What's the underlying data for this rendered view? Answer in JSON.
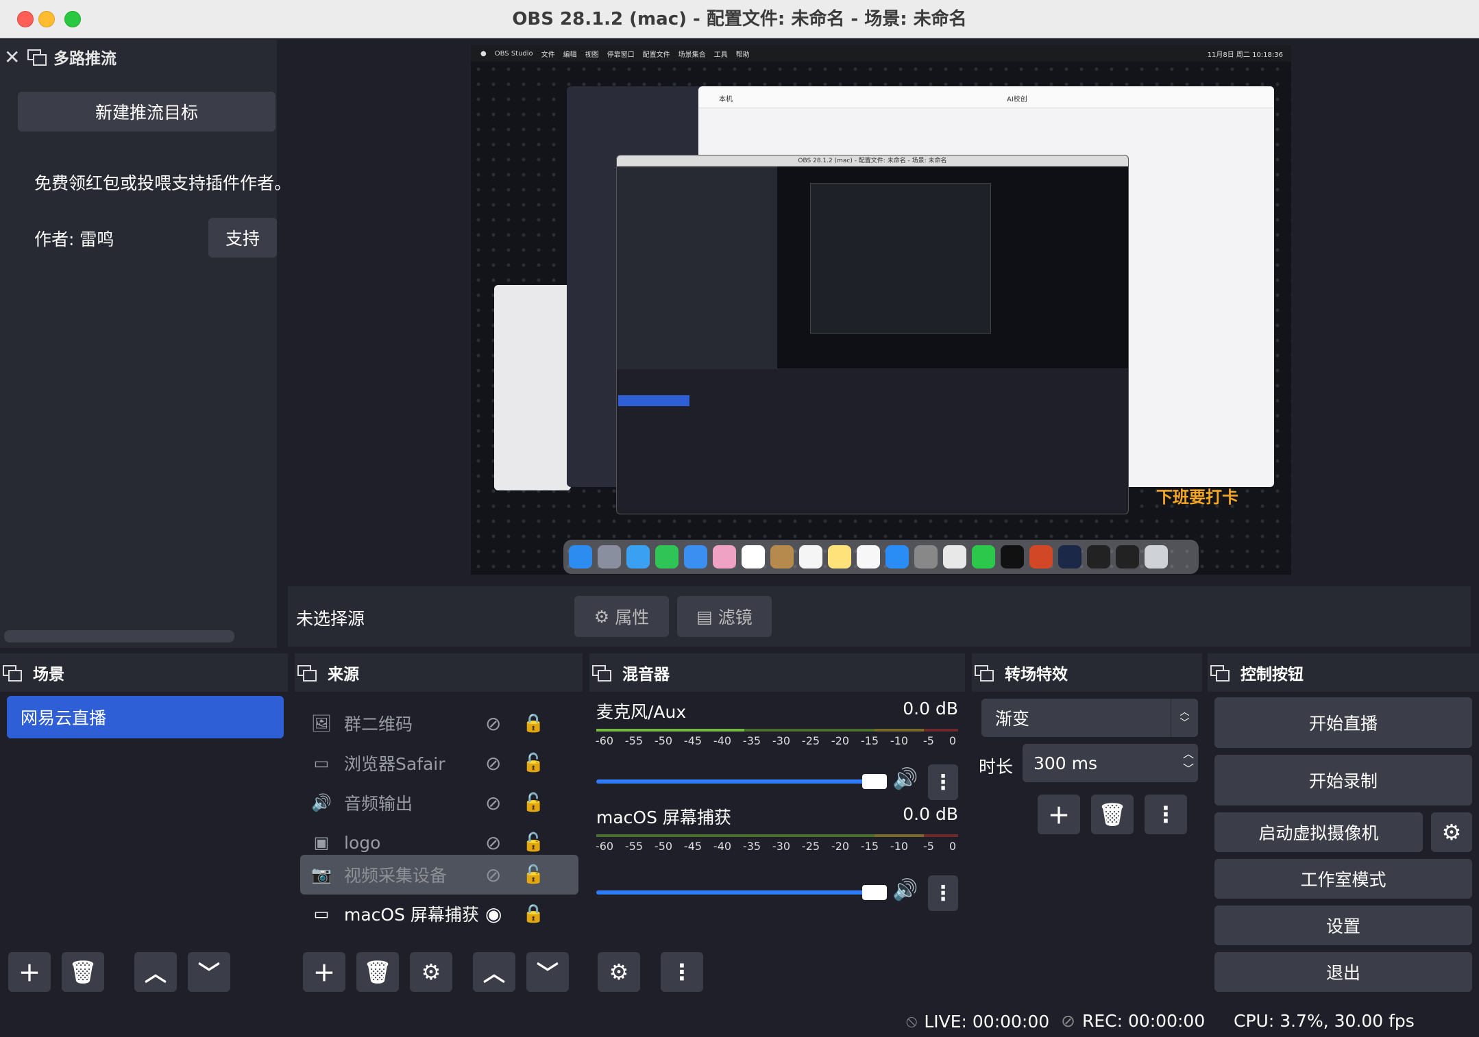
{
  "window": {
    "title": "OBS 28.1.2 (mac) - 配置文件: 未命名 - 场景: 未命名"
  },
  "multistream": {
    "title": "多路推流",
    "new_target": "新建推流目标",
    "support_text": "免费领红包或投喂支持插件作者。",
    "author": "作者: 雷鸣",
    "support_button": "支持"
  },
  "preview": {
    "overlay_text": "下班要打卡",
    "menubar_items": [
      "OBS Studio",
      "文件",
      "编辑",
      "视图",
      "停靠窗口",
      "配置文件",
      "场景集合",
      "工具",
      "帮助"
    ],
    "clock": "11月8日 周二 10:18:36",
    "nested_window_title": "OBS 28.1.2 (mac) - 配置文件: 未命名 - 场景: 未命名",
    "file_window_title": "本机",
    "file_window_title2": "AI校创"
  },
  "source_toolbar": {
    "no_source": "未选择源",
    "properties": "属性",
    "filters": "滤镜"
  },
  "scenes": {
    "title": "场景",
    "items": [
      "网易云直播"
    ]
  },
  "sources": {
    "title": "来源",
    "items": [
      {
        "label": "群二维码",
        "icon": "image-icon"
      },
      {
        "label": "浏览器Safair",
        "icon": "browser-icon"
      },
      {
        "label": "音频输出",
        "icon": "speaker-icon"
      },
      {
        "label": "logo",
        "icon": "slideshow-icon"
      },
      {
        "label": "视频采集设备",
        "icon": "camera-icon"
      },
      {
        "label": "macOS 屏幕捕获",
        "icon": "monitor-icon"
      }
    ]
  },
  "mixer": {
    "title": "混音器",
    "channels": [
      {
        "name": "麦克风/Aux",
        "db": "0.0 dB",
        "volume": 0.93
      },
      {
        "name": "macOS 屏幕捕获",
        "db": "0.0 dB",
        "volume": 0.93
      }
    ],
    "ticks": [
      "-60",
      "-55",
      "-50",
      "-45",
      "-40",
      "-35",
      "-30",
      "-25",
      "-20",
      "-15",
      "-10",
      "-5",
      "0"
    ]
  },
  "transitions": {
    "title": "转场特效",
    "selected": "渐变",
    "duration_label": "时长",
    "duration_value": "300 ms"
  },
  "controls": {
    "title": "控制按钮",
    "start_stream": "开始直播",
    "start_record": "开始录制",
    "virtual_cam": "启动虚拟摄像机",
    "studio_mode": "工作室模式",
    "settings": "设置",
    "exit": "退出"
  },
  "status": {
    "live": "LIVE: 00:00:00",
    "rec": "REC: 00:00:00",
    "cpu": "CPU: 3.7%, 30.00 fps"
  },
  "colors": {
    "accent": "#2f5fd6",
    "panel": "#272a33",
    "background": "#1e1f29",
    "button": "#3b3e48",
    "slider": "#2f7cf6"
  }
}
